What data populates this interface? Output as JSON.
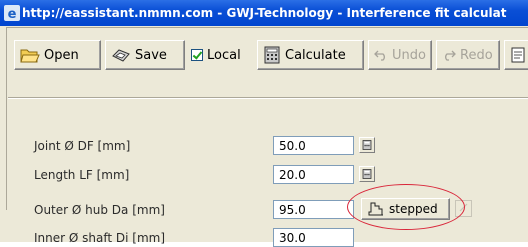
{
  "window": {
    "title": "http://eassistant.nmmn.com - GWJ-Technology - Interference fit calculat"
  },
  "toolbar": {
    "open_label": "Open",
    "save_label": "Save",
    "local_label": "Local",
    "local_checked": true,
    "calculate_label": "Calculate",
    "undo_label": "Undo",
    "redo_label": "Redo"
  },
  "form": {
    "rows": [
      {
        "label": "Joint Ø DF [mm]",
        "value": "50.0"
      },
      {
        "label": "Length LF [mm]",
        "value": "20.0"
      },
      {
        "label": "Outer Ø hub Da [mm]",
        "value": "95.0"
      },
      {
        "label": "Inner Ø shaft Di [mm]",
        "value": "30.0"
      }
    ],
    "stepped_label": "stepped"
  },
  "colors": {
    "titlebar": "#0a4fd6",
    "frame": "#ece9d8",
    "highlight": "#d9263a",
    "field_border": "#7f9db9"
  },
  "icons": {
    "open": "folder-open-icon",
    "save": "save-icon",
    "calculate": "calculator-icon",
    "undo": "undo-icon",
    "redo": "redo-icon",
    "stepped": "stepped-shaft-icon"
  }
}
